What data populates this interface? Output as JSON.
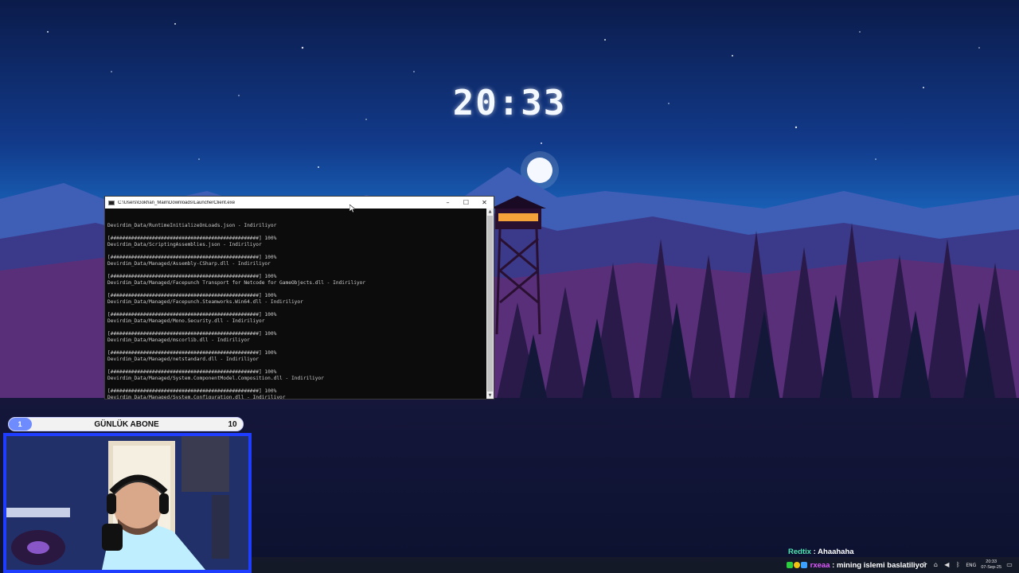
{
  "clock": {
    "time": "20:33"
  },
  "console": {
    "title": "C:\\Users\\Gokhan_Main\\Downloads\\LauncherClient.exe",
    "lines": [
      "Devirdim_Data/RuntimeInitializeOnLoads.json - Indiriliyor",
      "",
      "[##################################################] 100%",
      "Devirdim_Data/ScriptingAssemblies.json - Indiriliyor",
      "",
      "[##################################################] 100%",
      "Devirdim_Data/Managed/Assembly-CSharp.dll - Indiriliyor",
      "",
      "[##################################################] 100%",
      "Devirdim_Data/Managed/Facepunch Transport for Netcode for GameObjects.dll - Indiriliyor",
      "",
      "[##################################################] 100%",
      "Devirdim_Data/Managed/Facepunch.Steamworks.Win64.dll - Indiriliyor",
      "",
      "[##################################################] 100%",
      "Devirdim_Data/Managed/Mono.Security.dll - Indiriliyor",
      "",
      "[##################################################] 100%",
      "Devirdim_Data/Managed/mscorlib.dll - Indiriliyor",
      "",
      "[##################################################] 100%",
      "Devirdim_Data/Managed/netstandard.dll - Indiriliyor",
      "",
      "[##################################################] 100%",
      "Devirdim_Data/Managed/System.ComponentModel.Composition.dll - Indiriliyor",
      "",
      "[##################################################] 100%",
      "Devirdim_Data/Managed/System.Configuration.dll - Indiriliyor"
    ],
    "minimize": "–",
    "maximize": "☐",
    "close": "✕"
  },
  "goal": {
    "current": "1",
    "label": "GÜNLÜK ABONE",
    "target": "10",
    "progress": 0.1,
    "fill_color": "#6f8cff"
  },
  "chat": [
    {
      "user": "Redtix",
      "separator": " : ",
      "message": "Ahaahaha"
    },
    {
      "user": "rxeaa",
      "separator": " : ",
      "message": "mining islemi baslatiliyor"
    }
  ],
  "taskbar": {
    "language": "ENG",
    "time": "20:33",
    "date": "07-Sep-25"
  },
  "colors": {
    "webcam_border": "#1f3dff",
    "console_bg": "#0c0c0c"
  }
}
